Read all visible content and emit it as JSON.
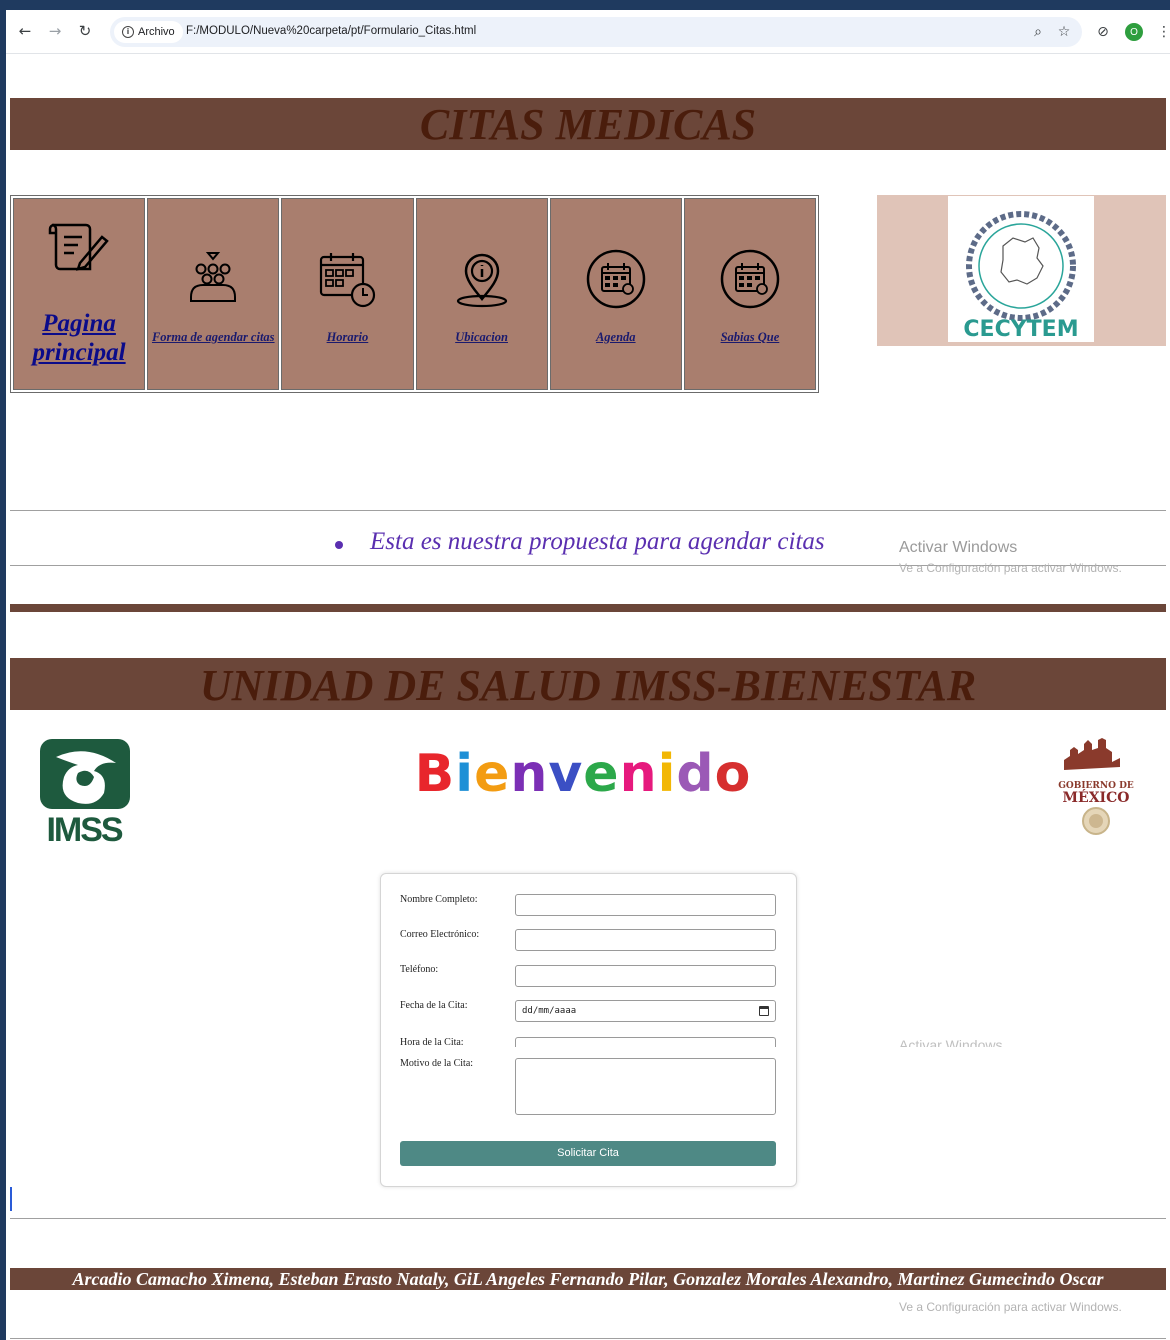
{
  "browser": {
    "site_chip": "Archivo",
    "url": "F:/MODULO/Nueva%20carpeta/pt/Formulario_Citas.html",
    "profile_initial": "O"
  },
  "header": {
    "title": "CITAS MEDICAS"
  },
  "nav": {
    "items": [
      {
        "label": "Pagina principal",
        "icon": "scroll-pen-icon"
      },
      {
        "label": "Forma de agendar citas",
        "icon": "group-people-icon"
      },
      {
        "label": "Horario",
        "icon": "calendar-clock-icon"
      },
      {
        "label": "Ubicacion",
        "icon": "location-pin-icon"
      },
      {
        "label": "Agenda",
        "icon": "calendar-circle-icon"
      },
      {
        "label": "Sabias Que",
        "icon": "calendar-circle-icon"
      }
    ]
  },
  "cecytem_logo": {
    "name": "CECYTEM",
    "ring_text": "COLEGIO DE ESTUDIOS CIENTÍFICOS Y TECNOLÓGICOS DEL ESTADO DE MÉXICO"
  },
  "proposal": {
    "text": "Esta es nuestra propuesta para agendar citas"
  },
  "watermark": {
    "title": "Activar Windows",
    "subtitle": "Ve a Configuración para activar Windows."
  },
  "unit_banner": {
    "title": "UNIDAD DE SALUD IMSS-BIENESTAR"
  },
  "logos": {
    "imss": "IMSS",
    "gobierno_line1": "GOBIERNO DE",
    "gobierno_line2": "MÉXICO",
    "welcome": "Bienvenido"
  },
  "welcome_colors": [
    "#e8262c",
    "#1e90d6",
    "#f39c12",
    "#7b2fb5",
    "#3b4fc4",
    "#2ca84a",
    "#e6197d",
    "#f2b705",
    "#9b59b6",
    "#d62f2f"
  ],
  "form": {
    "fields": [
      {
        "label": "Nombre Completo:",
        "value": ""
      },
      {
        "label": "Correo Electrónico:",
        "value": ""
      },
      {
        "label": "Teléfono:",
        "value": ""
      },
      {
        "label": "Fecha de la Cita:",
        "value": "dd/mm/aaaa"
      },
      {
        "label": "Hora de la Cita:",
        "value": ""
      },
      {
        "label": "Motivo de la Cita:",
        "value": ""
      }
    ],
    "submit_label": "Solicitar Cita"
  },
  "footer": {
    "authors": "Arcadio Camacho Ximena, Esteban Erasto Nataly, GiL Angeles Fernando Pilar, Gonzalez Morales Alexandro, Martinez Gumecindo Oscar"
  }
}
